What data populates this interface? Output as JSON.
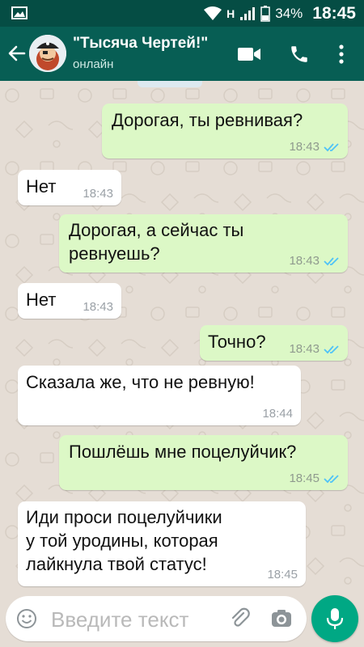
{
  "status_bar": {
    "network": "H",
    "battery": "34%",
    "time": "18:45"
  },
  "app_bar": {
    "title": "\"Тысяча Чертей!\"",
    "subtitle": "онлайн"
  },
  "messages": [
    {
      "direction": "out",
      "text": "Дорогая, ты ревнивая?",
      "time": "18:43",
      "read": true
    },
    {
      "direction": "in",
      "text": "Нет",
      "time": "18:43"
    },
    {
      "direction": "out",
      "text": "Дорогая, а сейчас ты\nревнуешь?",
      "time": "18:43",
      "read": true
    },
    {
      "direction": "in",
      "text": "Нет",
      "time": "18:43"
    },
    {
      "direction": "out",
      "text": "Точно?",
      "time": "18:43",
      "read": true
    },
    {
      "direction": "in",
      "text": "Сказала же, что не ревную!",
      "time": "18:44"
    },
    {
      "direction": "out",
      "text": "Пошлёшь мне поцелуйчик?",
      "time": "18:45",
      "read": true
    },
    {
      "direction": "in",
      "text": "Иди проси поцелуйчики\nу той уродины, которая\nлайкнула твой статус!",
      "time": "18:45"
    }
  ],
  "composer": {
    "placeholder": "Введите текст"
  },
  "icons": {
    "back": "arrow-left-icon",
    "video": "video-call-icon",
    "call": "phone-icon",
    "menu": "more-vertical-icon",
    "emoji": "emoji-icon",
    "attach": "paperclip-icon",
    "camera": "camera-icon",
    "mic": "microphone-icon"
  },
  "colors": {
    "status_bar": "#054d44",
    "app_bar": "#075e54",
    "chat_bg": "#e5ddd5",
    "outgoing_bubble": "#dcf8c6",
    "incoming_bubble": "#ffffff",
    "read_ticks": "#4fc3f7",
    "mic_button": "#00a884"
  }
}
